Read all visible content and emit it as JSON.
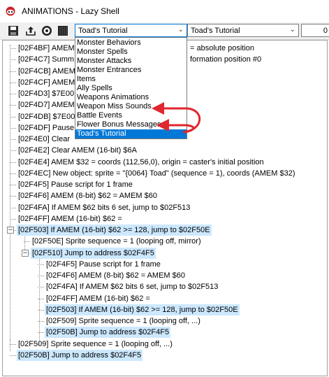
{
  "window": {
    "title": "ANIMATIONS - Lazy Shell"
  },
  "toolbar": {
    "combo1_value": "Toad's Tutorial",
    "combo2_value": "Toad's Tutorial",
    "number_value": "0",
    "icons": [
      "save-icon",
      "import-export-icon",
      "help-icon",
      "grid-icon"
    ]
  },
  "dropdown": {
    "items": [
      "Monster Behaviors",
      "Monster Spells",
      "Monster Attacks",
      "Monster Entrances",
      "Items",
      "Ally Spells",
      "Weapons Animations",
      "Weapon Miss Sounds",
      "Battle Events",
      "Flower Bonus Messages",
      "Toad's Tutorial"
    ],
    "selected": "Toad's Tutorial"
  },
  "tree": {
    "rows": [
      "[02F4BF]  AMEM",
      "[02F4C7]  Summ",
      "[02F4CB]  AMEM",
      "[02F4CF]  AMEM",
      "[02F4D3]  $7E00",
      "[02F4D7]  AMEM",
      "[02F4DB]  $7E00",
      "[02F4DF]  Pause",
      "[02F4E0]  Clear",
      "[02F4E2]  Clear AMEM (16-bit) $6A",
      "[02F4E4]  AMEM $32 = coords (112,56,0), origin = caster's initial position",
      "[02F4EC]  New object: sprite = \"{0064}  Toad\" (sequence = 1), coords (AMEM $32)",
      "[02F4F5]  Pause script for 1 frame",
      "[02F4F6]  AMEM (8-bit) $62 = AMEM $60",
      "[02F4FA]  If AMEM $62 bits 6 set, jump to $02F513",
      "[02F4FF]  AMEM (16-bit) $62 =",
      "[02F503]  If AMEM (16-bit) $62 >= 128, jump to $02F50E",
      "[02F50E]  Sprite sequence = 1 (looping off, mirror)",
      "[02F510]  Jump to address $02F4F5",
      "[02F4F5]  Pause script for 1 frame",
      "[02F4F6]  AMEM (8-bit) $62 = AMEM $60",
      "[02F4FA]  If AMEM $62 bits 6 set, jump to $02F513",
      "[02F4FF]  AMEM (16-bit) $62 =",
      "[02F503]  If AMEM (16-bit) $62 >= 128, jump to $02F50E",
      "[02F509]  Sprite sequence = 1 (looping off, ...)",
      "[02F50B]  Jump to address $02F4F5",
      "[02F509]  Sprite sequence = 1 (looping off, ...)",
      "[02F50B]  Jump to address $02F4F5"
    ],
    "partial_suffixes": [
      "= absolute position",
      "formation position #0"
    ]
  },
  "colors": {
    "selected_bg": "#0078d7",
    "highlight_bg": "#cce8ff",
    "annotation_arrow": "#e0262e"
  }
}
